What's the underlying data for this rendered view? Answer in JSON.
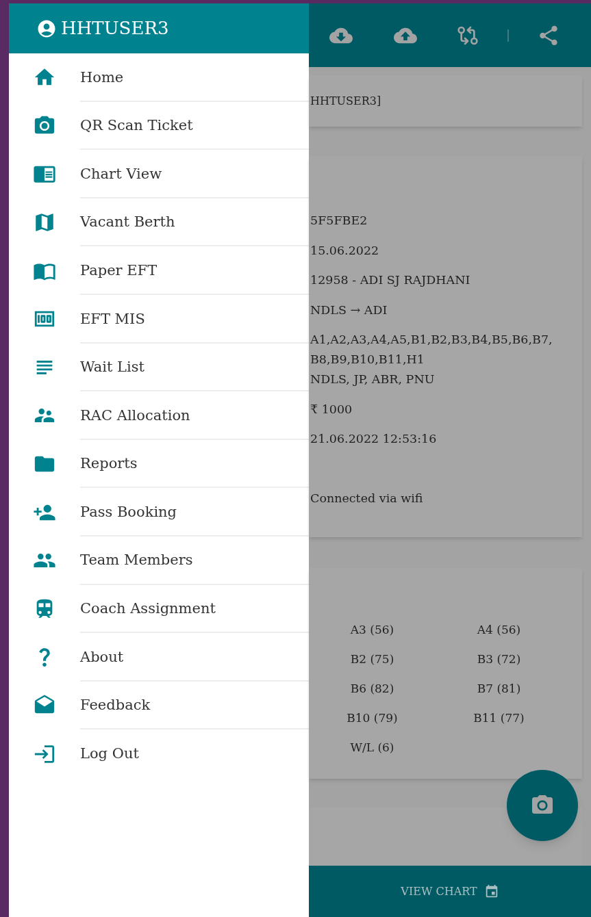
{
  "drawer": {
    "user": "HHTUSER3",
    "items": [
      {
        "label": "Home"
      },
      {
        "label": "QR Scan Ticket"
      },
      {
        "label": "Chart View"
      },
      {
        "label": "Vacant Berth"
      },
      {
        "label": "Paper EFT"
      },
      {
        "label": "EFT MIS"
      },
      {
        "label": "Wait List"
      },
      {
        "label": "RAC Allocation"
      },
      {
        "label": "Reports"
      },
      {
        "label": "Pass Booking"
      },
      {
        "label": "Team Members"
      },
      {
        "label": "Coach Assignment"
      },
      {
        "label": "About"
      },
      {
        "label": "Feedback"
      },
      {
        "label": "Log Out"
      }
    ]
  },
  "user_card": {
    "text": "HHTUSER3]"
  },
  "details": {
    "values": [
      "5F5FBE2",
      "15.06.2022",
      "12958 - ADI SJ RAJDHANI",
      "NDLS → ADI",
      "A1,A2,A3,A4,A5,B1,B2,B3,B4,B5,B6,B7,B8,B9,B10,B11,H1",
      "NDLS, JP, ABR, PNU",
      "₹ 1000",
      "21.06.2022 12:53:16"
    ],
    "connection": "Connected via wifi"
  },
  "coaches": [
    "A3 (56)",
    "A4 (56)",
    "B2 (75)",
    "B3 (72)",
    "B6 (82)",
    "B7 (81)",
    "B10 (79)",
    "B11 (77)",
    "W/L (6)"
  ],
  "bottom_button": {
    "label": "VIEW CHART"
  }
}
